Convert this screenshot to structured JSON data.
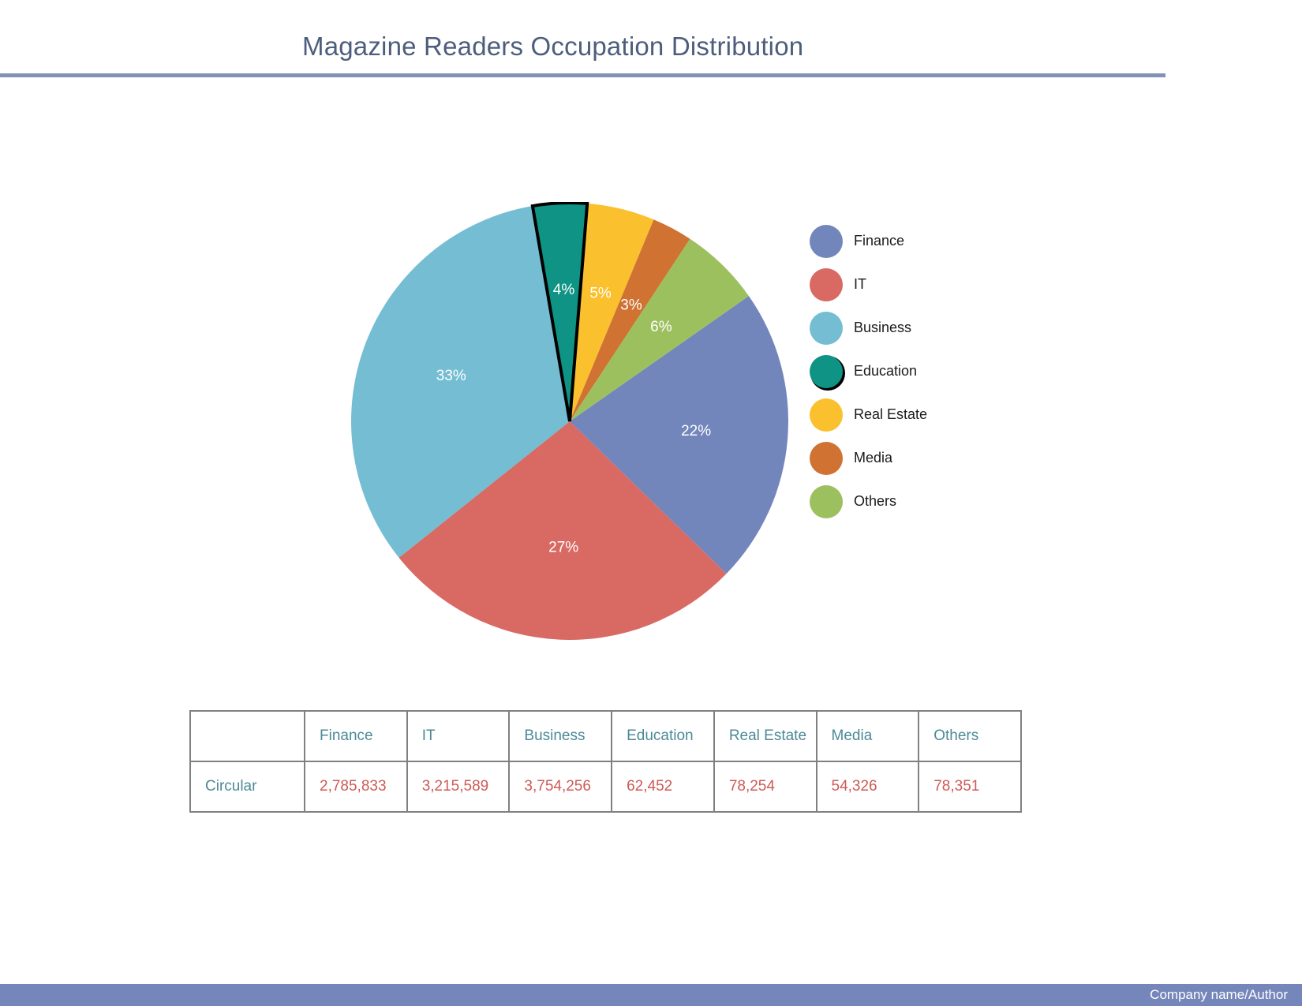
{
  "header": {
    "title": "Magazine Readers Occupation Distribution",
    "rule_color": "#8193b5"
  },
  "legend": {
    "items": [
      {
        "label": "Finance",
        "color": "#7386bc",
        "emphasis": false
      },
      {
        "label": " IT",
        "color": "#d96a63",
        "emphasis": false
      },
      {
        "label": "Business",
        "color": "#74bdd3",
        "emphasis": false
      },
      {
        "label": "Education",
        "color": "#0e9384",
        "emphasis": true
      },
      {
        "label": "Real Estate",
        "color": "#fbc02d",
        "emphasis": false
      },
      {
        "label": "Media",
        "color": "#cf7232",
        "emphasis": false
      },
      {
        "label": "Others",
        "color": "#9dc05f",
        "emphasis": false
      }
    ]
  },
  "chart_data": {
    "type": "pie",
    "title": "Magazine Readers Occupation Distribution",
    "categories": [
      "Finance",
      "IT",
      "Business",
      "Education",
      "Real Estate",
      "Media",
      "Others"
    ],
    "percent_labels": [
      "22%",
      "27%",
      "33%",
      "4%",
      "5%",
      "3%",
      "6%"
    ],
    "values": [
      22,
      27,
      33,
      4,
      5,
      3,
      6
    ],
    "raw_values": [
      "2,785,833",
      "3,215,589",
      "3,754,256",
      "62,452",
      "78,254",
      "54,326",
      "78,351"
    ],
    "colors": [
      "#7386bc",
      "#d96a63",
      "#74bdd3",
      "#0e9384",
      "#fbc02d",
      "#cf7232",
      "#9dc05f"
    ],
    "label_color": "#ffffff",
    "legend_position": "right",
    "highlighted_slice": "Education",
    "highlight_outline_color": "#000000",
    "start_angle_deg": -35
  },
  "table": {
    "columns": [
      "",
      "Finance",
      "IT",
      "Business",
      "Education",
      "Real Estate",
      "Media",
      "Others"
    ],
    "rows": [
      {
        "label": "Circular",
        "values": [
          "2,785,833",
          "3,215,589",
          "3,754,256",
          "62,452",
          "78,254",
          "54,326",
          "78,351"
        ]
      }
    ],
    "header_color": "#4c8a97",
    "value_color": "#cd5a56",
    "border_color": "#808080"
  },
  "footer": {
    "text": "Company  name/Author",
    "bar_color": "#7586ba"
  }
}
